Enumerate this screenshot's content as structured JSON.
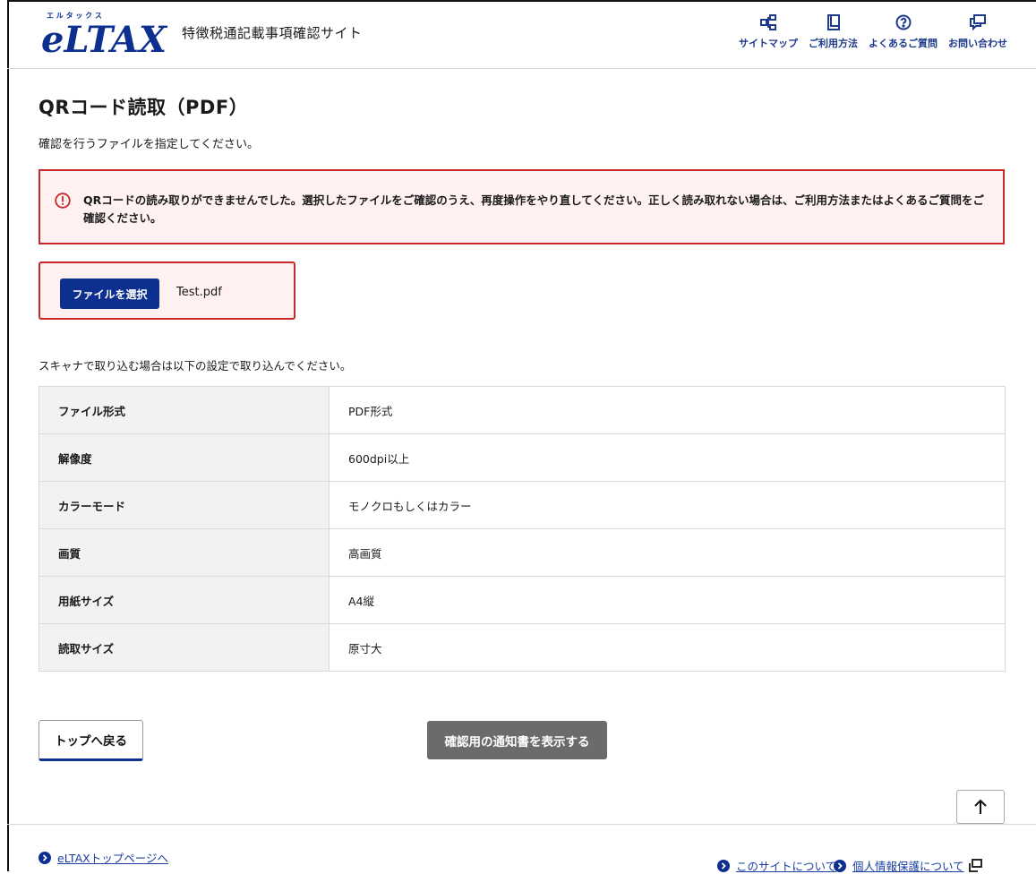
{
  "header": {
    "logo_text": "eLTAX",
    "logo_ruby": "エ ル タ ッ ク ス",
    "site_title": "特徴税通記載事項確認サイト",
    "nav": [
      {
        "label": "サイトマップ",
        "icon": "sitemap-icon"
      },
      {
        "label": "ご利用方法",
        "icon": "book-icon"
      },
      {
        "label": "よくあるご質問",
        "icon": "question-icon"
      },
      {
        "label": "お問い合わせ",
        "icon": "chat-icon"
      }
    ]
  },
  "page": {
    "title": "QRコード読取（PDF）",
    "intro": "確認を行うファイルを指定してください。"
  },
  "error": {
    "message": "QRコードの読み取りができませんでした。選択したファイルをご確認のうえ、再度操作をやり直してください。正しく読み取れない場合は、ご利用方法またはよくあるご質問をご確認ください。"
  },
  "file": {
    "button_label": "ファイルを選択",
    "file_name": "Test.pdf"
  },
  "scan": {
    "note": "スキャナで取り込む場合は以下の設定で取り込んでください。",
    "rows": [
      {
        "key": "ファイル形式",
        "value": "PDF形式"
      },
      {
        "key": "解像度",
        "value": "600dpi以上"
      },
      {
        "key": "カラーモード",
        "value": "モノクロもしくはカラー"
      },
      {
        "key": "画質",
        "value": "高画質"
      },
      {
        "key": "用紙サイズ",
        "value": "A4縦"
      },
      {
        "key": "読取サイズ",
        "value": "原寸大"
      }
    ]
  },
  "actions": {
    "back_label": "トップへ戻る",
    "show_label": "確認用の通知書を表示する"
  },
  "footer": {
    "eltax_link": "eLTAXトップページへ",
    "about_link": "このサイトについて",
    "privacy_link": "個人情報保護について"
  },
  "colors": {
    "brand": "#0d2f8f",
    "error_border": "#c62828",
    "error_bg": "#fff1f1",
    "disabled_button": "#6b6b6b"
  }
}
